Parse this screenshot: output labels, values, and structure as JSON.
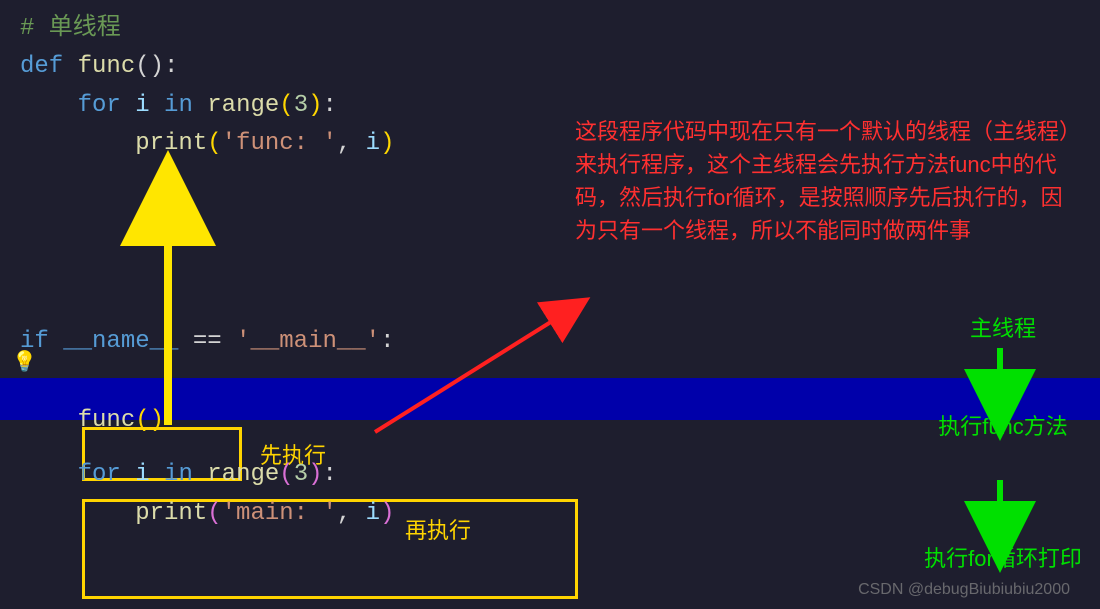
{
  "code": {
    "l1": "# 单线程",
    "l2_def": "def",
    "l2_func": " func",
    "l2_close": "():",
    "l3_for": "    for",
    "l3_var": " i",
    "l3_in": " in",
    "l3_range": " range",
    "l3_p2o": "(",
    "l3_num": "3",
    "l3_p2c": ")",
    "l3_colon": ":",
    "l4_print": "        print",
    "l4_po": "(",
    "l4_str": "'func: '",
    "l4_comma": ",",
    "l4_var": " i",
    "l4_pc": ")",
    "l5_if": "if",
    "l5_name": " __name__",
    "l5_eq": " ==",
    "l5_main": " '__main__'",
    "l5_colon": ":",
    "l6_p1": "    ",
    "l6_func": "func",
    "l6_p": "()",
    "l7_p1": "    ",
    "l7_for": "for",
    "l7_var": " i",
    "l7_in": " in",
    "l7_range": " range",
    "l7_p2o": "(",
    "l7_num": "3",
    "l7_p2c": ")",
    "l7_colon": ":",
    "l8_print": "        print",
    "l8_po": "(",
    "l8_str": "'main: '",
    "l8_comma": ",",
    "l8_var": " i",
    "l8_pc": ")"
  },
  "ann": {
    "red_note": "这段程序代码中现在只有一个默认的线程（主线程）来执行程序，这个主线程会先执行方法func中的代码，然后执行for循环，是按照顺序先后执行的，因为只有一个线程，所以不能同时做两件事",
    "label_first": "先执行",
    "label_second": "再执行",
    "g1": "主线程",
    "g2": "执行func方法",
    "g3": "执行for循环打印"
  },
  "watermark": "CSDN @debugBiubiubiu2000",
  "icons": {
    "bulb": "💡"
  }
}
